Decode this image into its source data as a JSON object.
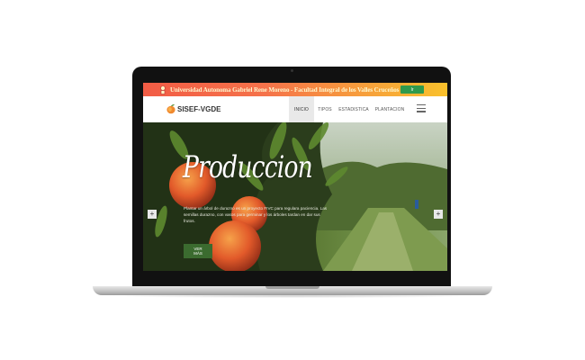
{
  "banner": {
    "text": "Universidad Autonoma Gabriel Rene Moreno - Facultad Integral de los Valles Cruceños FIVC",
    "button_label": "Ir"
  },
  "navbar": {
    "brand": "SISEF-VGDE",
    "items": [
      {
        "label": "INICIO",
        "active": true
      },
      {
        "label": "TIPOS",
        "active": false
      },
      {
        "label": "ESTADISTICA",
        "active": false
      },
      {
        "label": "PLANTACION",
        "active": false
      }
    ],
    "menu_icon": "hamburger-icon"
  },
  "hero": {
    "title": "Produccion",
    "description": "Plantar un árbol de durazno es un proyecto FIVC para regulara paciencia. Las semillas durazno, con vasos para germinar y los árboles tardan en dar sus frutos.",
    "button_label": "VER MÁS",
    "prev_icon": "chevron-left-icon",
    "next_icon": "chevron-right-icon"
  },
  "colors": {
    "banner_start": "#f25c45",
    "banner_end": "#f9c12c",
    "accent_green": "#3b6b2f",
    "ir_button": "#2f9a4d"
  }
}
